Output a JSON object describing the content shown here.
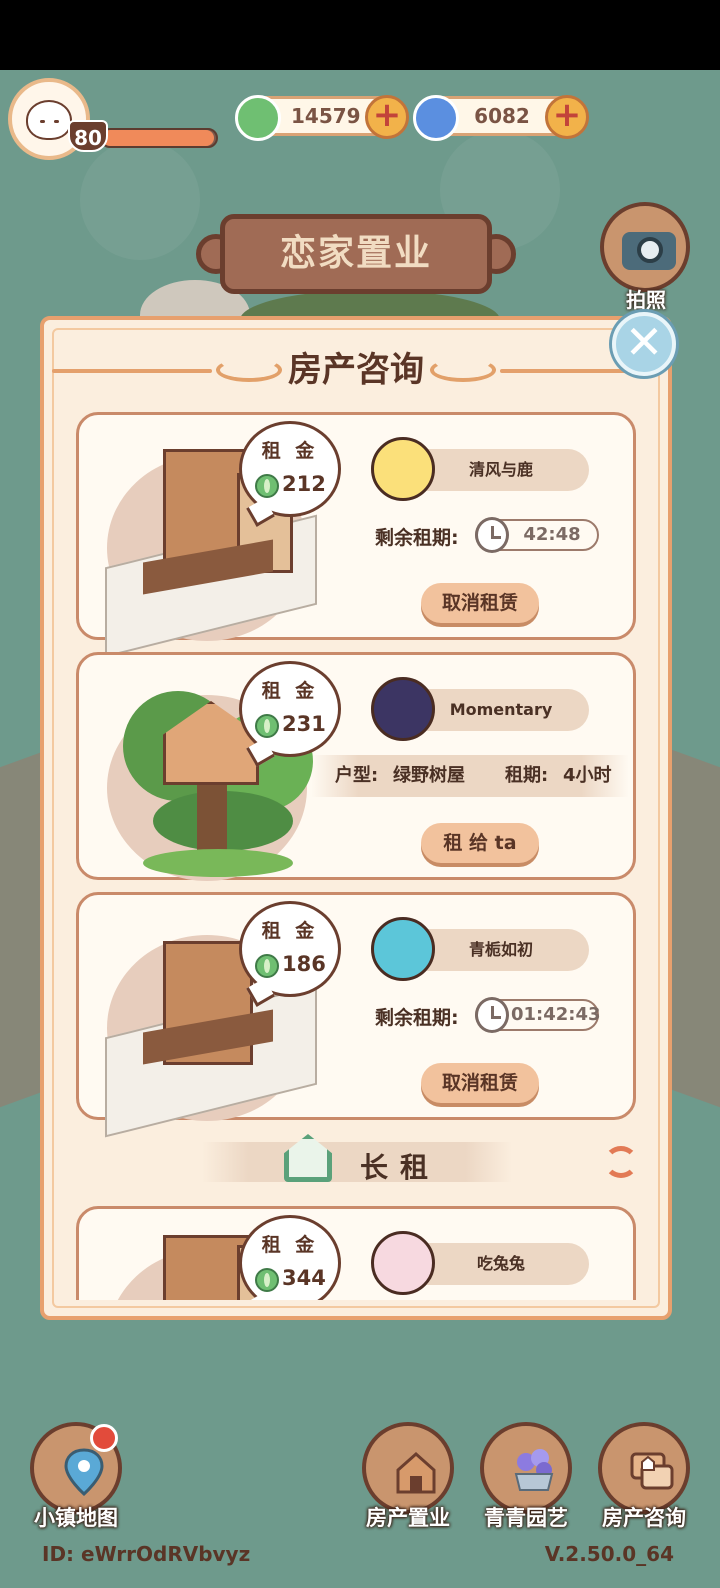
{
  "hud": {
    "level": "80",
    "xp_progress": 0.98,
    "currencies": [
      {
        "name": "clover-coin",
        "value": "14579",
        "color": "#6fbf72"
      },
      {
        "name": "blue-swirl-gem",
        "value": "6082",
        "color": "#5b8fe0"
      }
    ],
    "camera_label": "拍照"
  },
  "banner": {
    "title": "恋家置业"
  },
  "panel": {
    "title": "房产咨询",
    "rent_label": "租 金",
    "lease_remaining_label": "剩余租期:",
    "cards": [
      {
        "rent": "212",
        "user": "清风与鹿",
        "timer": "42:48",
        "action": "取消租赁"
      },
      {
        "rent": "231",
        "user": "Momentary",
        "type_label": "户型:",
        "type_value": "绿野树屋",
        "period_label": "租期:",
        "period_value": "4小时",
        "action": "租 给 ta"
      },
      {
        "rent": "186",
        "user": "青栀如初",
        "timer": "01:42:43",
        "action": "取消租赁"
      },
      {
        "rent": "344",
        "user": "吃兔兔"
      }
    ],
    "section_title": "长租"
  },
  "nav": {
    "items": [
      {
        "label": "小镇地图",
        "icon": "map-pin-icon"
      },
      {
        "label": "房产置业",
        "icon": "house-icon"
      },
      {
        "label": "青青园艺",
        "icon": "flower-cart-icon"
      },
      {
        "label": "房产咨询",
        "icon": "chat-house-icon"
      }
    ]
  },
  "footer": {
    "id": "ID: eWrrOdRVbvyz",
    "version": "V.2.50.0_64"
  },
  "colors": {
    "accent": "#e7a06e",
    "panel_bg": "#fbeede",
    "brown": "#6b3e2e",
    "bg": "#6e9a8c"
  }
}
